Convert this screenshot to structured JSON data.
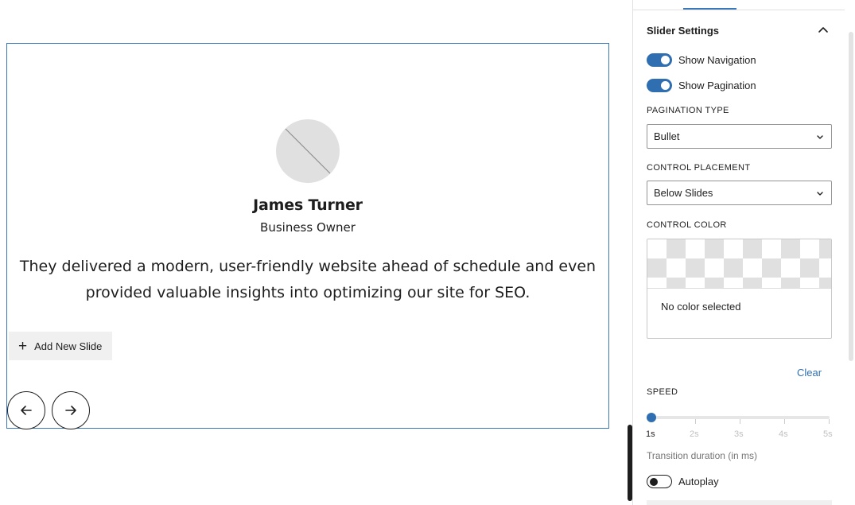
{
  "slide": {
    "name": "James Turner",
    "role": "Business Owner",
    "quote": "They delivered a modern, user-friendly website ahead of schedule and even provided valuable insights into optimizing our site for SEO.",
    "add_slide_label": "Add New Slide"
  },
  "panel": {
    "title": "Slider Settings",
    "show_navigation": {
      "label": "Show Navigation",
      "checked": true
    },
    "show_pagination": {
      "label": "Show Pagination",
      "checked": true
    },
    "pagination_type": {
      "label": "PAGINATION TYPE",
      "value": "Bullet"
    },
    "control_placement": {
      "label": "CONTROL PLACEMENT",
      "value": "Below Slides"
    },
    "control_color": {
      "label": "CONTROL COLOR",
      "value_text": "No color selected"
    },
    "clear_label": "Clear",
    "speed": {
      "label": "SPEED",
      "marks": [
        "1s",
        "2s",
        "3s",
        "4s",
        "5s"
      ],
      "value": "1s",
      "help": "Transition duration (in ms)"
    },
    "autoplay": {
      "label": "Autoplay",
      "checked": false
    }
  },
  "colors": {
    "accent": "#2f6fb1",
    "selection_border": "#3a78b8"
  }
}
